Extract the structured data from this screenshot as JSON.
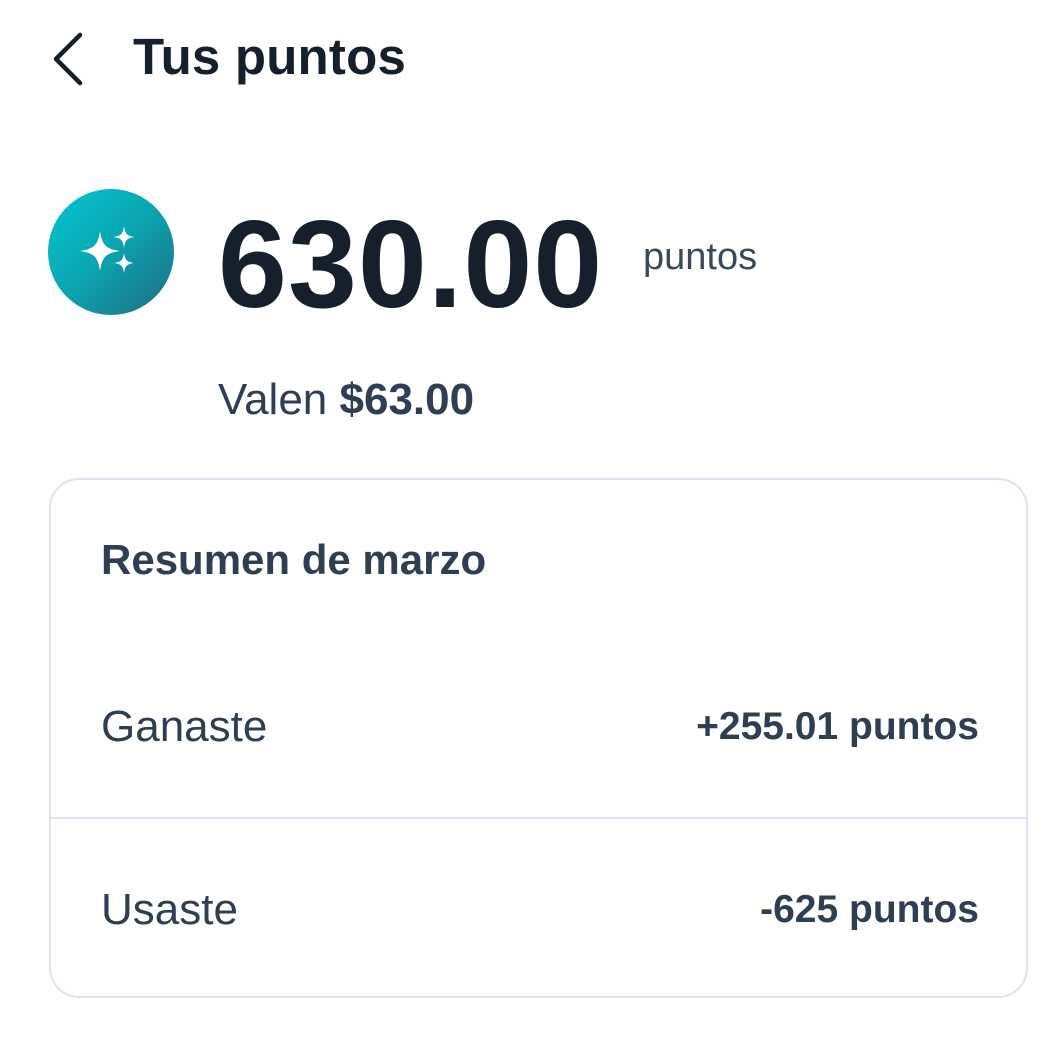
{
  "header": {
    "title": "Tus puntos",
    "back_icon": "chevron-left-icon"
  },
  "balance": {
    "icon": "sparkles-icon",
    "icon_colors": [
      "#07c6d3",
      "#1d6f83"
    ],
    "value": "630.00",
    "unit": "puntos",
    "worth_prefix": "Valen",
    "worth_amount": "$63.00"
  },
  "summary": {
    "title": "Resumen de marzo",
    "rows": [
      {
        "label": "Ganaste",
        "value": "+255.01 puntos"
      },
      {
        "label": "Usaste",
        "value": "-625 puntos"
      }
    ]
  },
  "colors": {
    "text_primary": "#16202c",
    "text_secondary": "#2f3e52",
    "card_border": "#e2e1ef"
  }
}
